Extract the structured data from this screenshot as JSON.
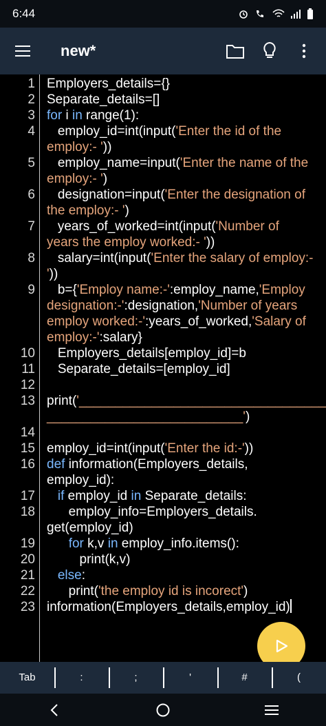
{
  "status": {
    "time": "6:44"
  },
  "appbar": {
    "title": "new*"
  },
  "editor": {
    "lines": [
      {
        "n": "1",
        "segments": [
          [
            "Employers_details={}",
            ""
          ]
        ]
      },
      {
        "n": "2",
        "segments": [
          [
            "Separate_details=[]",
            ""
          ]
        ]
      },
      {
        "n": "3",
        "segments": [
          [
            "for",
            "kw"
          ],
          [
            " i ",
            ""
          ],
          [
            "in",
            "kw"
          ],
          [
            " range(1):",
            ""
          ]
        ]
      },
      {
        "n": "4",
        "segments": [
          [
            "   employ_id=int(input(",
            ""
          ],
          [
            "'Enter the id of the",
            "str"
          ]
        ]
      },
      {
        "n": "",
        "segments": [
          [
            "employ:- '",
            "str"
          ],
          [
            "))",
            ""
          ]
        ]
      },
      {
        "n": "5",
        "segments": [
          [
            "   employ_name=input(",
            ""
          ],
          [
            "'Enter the name of the",
            "str"
          ]
        ]
      },
      {
        "n": "",
        "segments": [
          [
            "employ:- '",
            "str"
          ],
          [
            ")",
            ""
          ]
        ]
      },
      {
        "n": "6",
        "segments": [
          [
            "   designation=input(",
            ""
          ],
          [
            "'Enter the designation of",
            "str"
          ]
        ]
      },
      {
        "n": "",
        "segments": [
          [
            "the employ:- '",
            "str"
          ],
          [
            ")",
            ""
          ]
        ]
      },
      {
        "n": "7",
        "segments": [
          [
            "   years_of_worked=int(input(",
            ""
          ],
          [
            "'Number of",
            "str"
          ]
        ]
      },
      {
        "n": "",
        "segments": [
          [
            "years the employ worked:- '",
            "str"
          ],
          [
            "))",
            ""
          ]
        ]
      },
      {
        "n": "8",
        "segments": [
          [
            "   salary=int(input(",
            ""
          ],
          [
            "'Enter the salary of employ:-",
            "str"
          ]
        ]
      },
      {
        "n": "",
        "segments": [
          [
            "'",
            "str"
          ],
          [
            "))",
            ""
          ]
        ]
      },
      {
        "n": "9",
        "segments": [
          [
            "   b={",
            ""
          ],
          [
            "'Employ name:-'",
            "str"
          ],
          [
            ":employ_name,",
            ""
          ],
          [
            "'Employ",
            "str"
          ]
        ]
      },
      {
        "n": "",
        "segments": [
          [
            "designation:-'",
            "str"
          ],
          [
            ":designation,",
            ""
          ],
          [
            "'Number of years",
            "str"
          ]
        ]
      },
      {
        "n": "",
        "segments": [
          [
            "employ worked:-'",
            "str"
          ],
          [
            ":years_of_worked,",
            ""
          ],
          [
            "'Salary of",
            "str"
          ]
        ]
      },
      {
        "n": "",
        "segments": [
          [
            "employ:-'",
            "str"
          ],
          [
            ":salary}",
            ""
          ]
        ]
      },
      {
        "n": "10",
        "segments": [
          [
            "   Employers_details[employ_id]=b",
            ""
          ]
        ]
      },
      {
        "n": "11",
        "segments": [
          [
            "   Separate_details=[employ_id]",
            ""
          ]
        ]
      },
      {
        "n": "12",
        "segments": [
          [
            "",
            ""
          ]
        ]
      },
      {
        "n": "13",
        "segments": [
          [
            "print(",
            ""
          ],
          [
            "'___________________________________",
            "str"
          ]
        ]
      },
      {
        "n": "",
        "segments": [
          [
            "___________________________'",
            "str"
          ],
          [
            ")",
            ""
          ]
        ]
      },
      {
        "n": "14",
        "segments": [
          [
            "",
            ""
          ]
        ]
      },
      {
        "n": "15",
        "segments": [
          [
            "employ_id=int(input(",
            ""
          ],
          [
            "'Enter the id:-'",
            "str"
          ],
          [
            "))",
            ""
          ]
        ]
      },
      {
        "n": "16",
        "segments": [
          [
            "def",
            "kw"
          ],
          [
            " information(Employers_details,",
            ""
          ]
        ]
      },
      {
        "n": "",
        "segments": [
          [
            "employ_id):",
            ""
          ]
        ]
      },
      {
        "n": "17",
        "segments": [
          [
            "   ",
            ""
          ],
          [
            "if",
            "kw"
          ],
          [
            " employ_id ",
            ""
          ],
          [
            "in",
            "kw"
          ],
          [
            " Separate_details:",
            ""
          ]
        ]
      },
      {
        "n": "18",
        "segments": [
          [
            "      employ_info=Employers_details.",
            ""
          ]
        ]
      },
      {
        "n": "",
        "segments": [
          [
            "get(employ_id)",
            ""
          ]
        ]
      },
      {
        "n": "19",
        "segments": [
          [
            "      ",
            ""
          ],
          [
            "for",
            "kw"
          ],
          [
            " k,v ",
            ""
          ],
          [
            "in",
            "kw"
          ],
          [
            " employ_info.items():",
            ""
          ]
        ]
      },
      {
        "n": "20",
        "segments": [
          [
            "         print(k,v)",
            ""
          ]
        ]
      },
      {
        "n": "21",
        "segments": [
          [
            "   ",
            ""
          ],
          [
            "else",
            "kw"
          ],
          [
            ":",
            ""
          ]
        ]
      },
      {
        "n": "22",
        "segments": [
          [
            "      print(",
            ""
          ],
          [
            "'the employ id is incorect'",
            "str"
          ],
          [
            ")",
            ""
          ]
        ]
      },
      {
        "n": "23",
        "segments": [
          [
            "information(Employers_details,employ_id)",
            ""
          ]
        ]
      }
    ]
  },
  "keys": [
    "Tab",
    ":",
    ";",
    "'",
    "#",
    "("
  ],
  "icons": {
    "menu": "hamburger-menu-icon",
    "folder": "folder-icon",
    "bulb": "lightbulb-icon",
    "more": "more-vertical-icon",
    "run": "play-icon"
  },
  "colors": {
    "keyword": "#7ab8ff",
    "string": "#e6a57c",
    "appbar": "#1d2a3a",
    "fab": "#f7cf4d"
  }
}
